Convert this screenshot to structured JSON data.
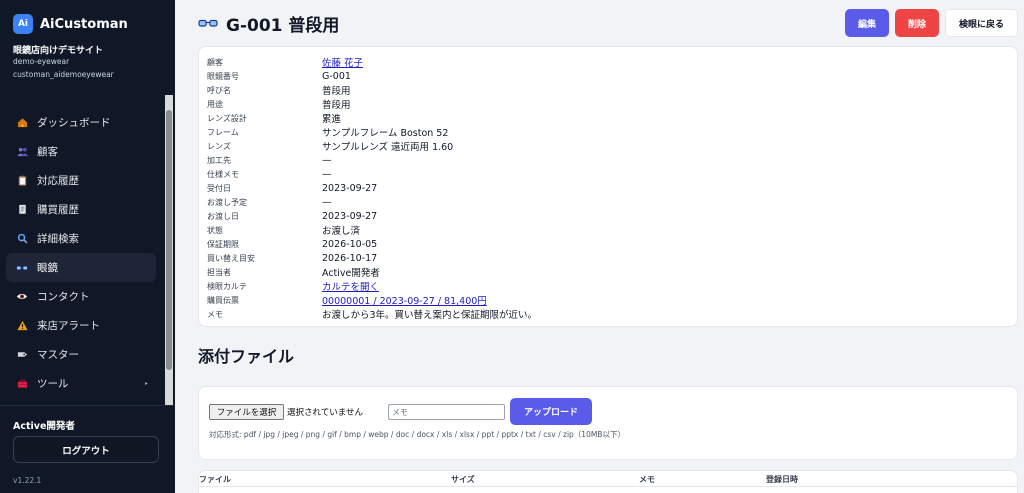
{
  "sidebar": {
    "brand": "AiCustoman",
    "logo_text": "Ai",
    "store_name": "眼鏡店向けデモサイト",
    "store_id": "demo-eyewear",
    "store_user": "customan_aidemoeyewear",
    "items": [
      {
        "label": "ダッシュボード",
        "icon": "home-icon"
      },
      {
        "label": "顧客",
        "icon": "users-icon"
      },
      {
        "label": "対応履歴",
        "icon": "clipboard-icon"
      },
      {
        "label": "購買履歴",
        "icon": "receipt-icon"
      },
      {
        "label": "詳細検索",
        "icon": "search-icon"
      },
      {
        "label": "眼鏡",
        "icon": "glasses-icon",
        "active": true
      },
      {
        "label": "コンタクト",
        "icon": "eye-icon"
      },
      {
        "label": "来店アラート",
        "icon": "warning-icon"
      },
      {
        "label": "マスター",
        "icon": "tag-icon"
      },
      {
        "label": "ツール",
        "icon": "toolbox-icon"
      }
    ],
    "current_user": "Active開発者",
    "logout_label": "ログアウト",
    "version": "v1.22.1"
  },
  "header": {
    "title": "G-001 普段用",
    "edit_label": "編集",
    "delete_label": "削除",
    "back_label": "検眼に戻る"
  },
  "details": [
    {
      "label": "顧客",
      "value": "佐藤 花子",
      "link": true
    },
    {
      "label": "眼鏡番号",
      "value": "G-001"
    },
    {
      "label": "呼び名",
      "value": "普段用"
    },
    {
      "label": "用途",
      "value": "普段用"
    },
    {
      "label": "レンズ設計",
      "value": "累進"
    },
    {
      "label": "フレーム",
      "value": "サンプルフレーム Boston 52"
    },
    {
      "label": "レンズ",
      "value": "サンプルレンズ 遠近両用 1.60"
    },
    {
      "label": "加工先",
      "value": "—"
    },
    {
      "label": "仕様メモ",
      "value": "—"
    },
    {
      "label": "受付日",
      "value": "2023-09-27"
    },
    {
      "label": "お渡し予定",
      "value": "—"
    },
    {
      "label": "お渡し日",
      "value": "2023-09-27"
    },
    {
      "label": "状態",
      "value": "お渡し済"
    },
    {
      "label": "保証期限",
      "value": "2026-10-05"
    },
    {
      "label": "買い替え目安",
      "value": "2026-10-17"
    },
    {
      "label": "担当者",
      "value": "Active開発者"
    },
    {
      "label": "検眼カルテ",
      "value": "カルテを開く",
      "link": true
    },
    {
      "label": "購買伝票",
      "value": "00000001 / 2023-09-27 / 81,400円",
      "link": true
    },
    {
      "label": "メモ",
      "value": "お渡しから3年。買い替え案内と保証期限が近い。"
    }
  ],
  "attachments": {
    "title": "添付ファイル",
    "choose_file_label": "ファイルを選択",
    "no_file_label": "選択されていません",
    "memo_placeholder": "メモ",
    "upload_label": "アップロード",
    "formats": "対応形式: pdf / jpg / jpeg / png / gif / bmp / webp / doc / docx / xls / xlsx / ppt / pptx / txt / csv / zip（10MB以下）",
    "columns": [
      "ファイル",
      "サイズ",
      "メモ",
      "登録日時"
    ]
  },
  "colors": {
    "sidebar_bg": "#101827",
    "primary": "#5b5bea",
    "danger": "#ef4444",
    "link": "#1d1dc2"
  }
}
